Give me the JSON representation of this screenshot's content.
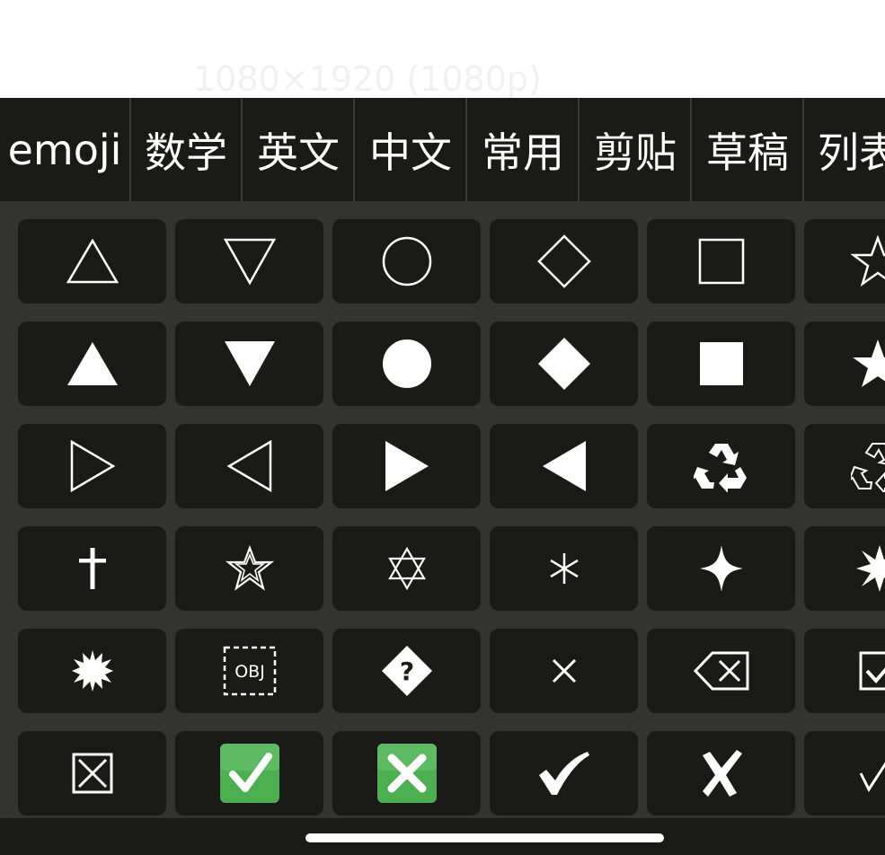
{
  "background_hint": "1080×1920 (1080p)",
  "tabs": [
    "emoji",
    "数学",
    "英文",
    "中文",
    "常用",
    "剪贴",
    "草稿",
    "列表"
  ],
  "keys": [
    [
      "△",
      "▽",
      "○",
      "◇",
      "□",
      "☆"
    ],
    [
      "▲",
      "▼",
      "●",
      "◆",
      "■",
      "★"
    ],
    [
      "▷",
      "◁",
      "▶",
      "◀",
      "♻",
      "♲"
    ],
    [
      "†",
      "✰",
      "✡",
      "⚹",
      "✦",
      "✸"
    ],
    [
      "✹",
      "OBJ",
      "?",
      "×",
      "⌫",
      "☑"
    ],
    [
      "⊠",
      "✅",
      "❎",
      "✔",
      "✗",
      "√"
    ]
  ],
  "colors": {
    "tabbar": "#1a1a18",
    "grid": "#333331",
    "key": "#1a1a18",
    "text": "#ffffff",
    "check_green": "#4caf50"
  }
}
